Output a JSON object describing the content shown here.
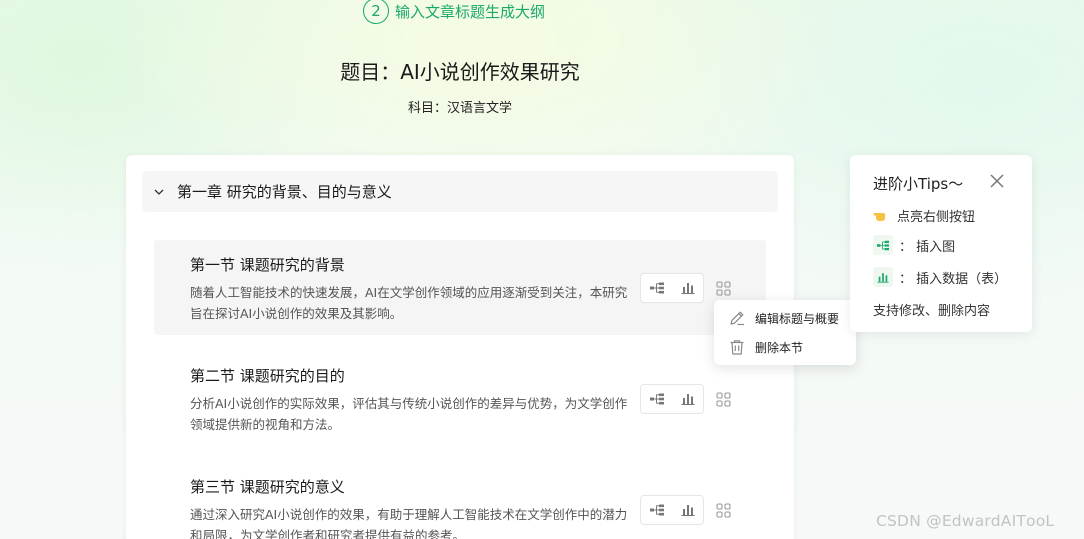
{
  "header": {
    "step_number": "2",
    "step_label": "输入文章标题生成大纲",
    "title": "题目：AI小说创作效果研究",
    "subject": "科目：汉语言文学"
  },
  "outline": {
    "chapter_title": "第一章 研究的背景、目的与意义",
    "sections": [
      {
        "title": "第一节 课题研究的背景",
        "desc": "随着人工智能技术的快速发展，AI在文学创作领域的应用逐渐受到关注，本研究旨在探讨AI小说创作的效果及其影响。"
      },
      {
        "title": "第二节 课题研究的目的",
        "desc": "分析AI小说创作的实际效果，评估其与传统小说创作的差异与优势，为文学创作领域提供新的视角和方法。"
      },
      {
        "title": "第三节 课题研究的意义",
        "desc": "通过深入研究AI小说创作的效果，有助于理解人工智能技术在文学创作中的潜力和局限，为文学创作者和研究者提供有益的参考。"
      }
    ]
  },
  "menu": {
    "edit_label": "编辑标题与概要",
    "delete_label": "删除本节"
  },
  "tips": {
    "title": "进阶小Tips～",
    "row1": "点亮右侧按钮",
    "row2": "： 插入图",
    "row3": "： 插入数据（表）",
    "row4": "支持修改、删除内容"
  },
  "watermark": "CSDN @EdwardAIТooL",
  "colors": {
    "accent": "#1aa86c",
    "muted_icon": "#8a8a8a"
  },
  "icons": [
    "insert-diagram-icon",
    "insert-chart-icon",
    "grid-more-icon",
    "pencil-icon",
    "trash-icon",
    "close-icon",
    "pointing-hand-icon",
    "chevron-down-icon"
  ]
}
